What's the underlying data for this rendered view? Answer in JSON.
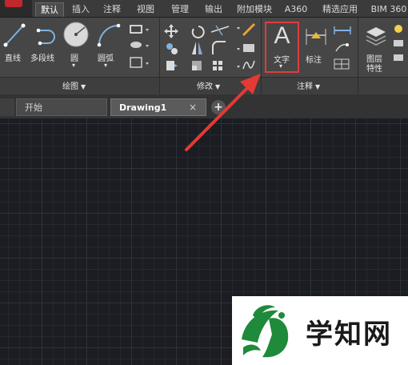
{
  "ribbon_tabs": [
    "默认",
    "插入",
    "注释",
    "视图",
    "管理",
    "输出",
    "附加模块",
    "A360",
    "精选应用",
    "BIM 360"
  ],
  "draw_tools": {
    "line": "直线",
    "polyline": "多段线",
    "circle": "圆",
    "arc": "圆弧"
  },
  "panels": {
    "draw": "绘图",
    "modify": "修改",
    "annotation": "注释"
  },
  "annot_tools": {
    "text": "文字",
    "text_glyph": "A",
    "dimension": "标注"
  },
  "layer_tool": {
    "line1": "图层",
    "line2": "特性"
  },
  "doc_tabs": {
    "start": "开始",
    "drawing": "Drawing1",
    "close": "×",
    "add": "+"
  },
  "watermark": {
    "text": "学知网"
  },
  "colors": {
    "highlight_box": "#e03c3c",
    "arrow": "#e53935",
    "logo_green": "#1e8a3a",
    "ribbon": "#464646",
    "canvas": "#1b1d22"
  },
  "icons": [
    "line-icon",
    "polyline-icon",
    "circle-icon",
    "arc-icon",
    "move-icon",
    "rotate-icon",
    "trim-icon",
    "copy-icon",
    "mirror-icon",
    "fillet-icon",
    "stretch-icon",
    "scale-icon",
    "array-icon",
    "text-icon",
    "dimension-icon",
    "layer-properties-icon"
  ]
}
